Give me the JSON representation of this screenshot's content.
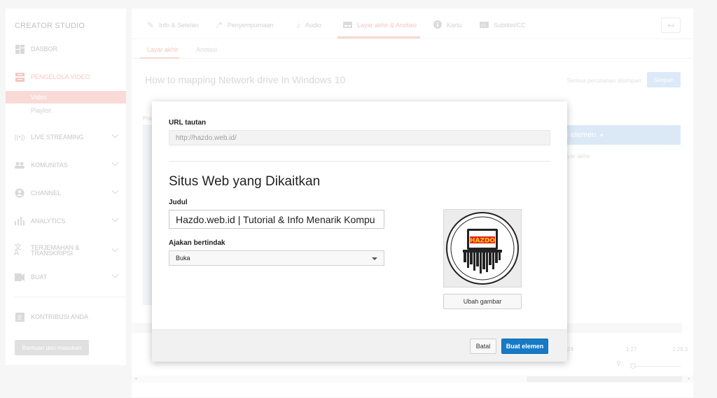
{
  "sidebar": {
    "studio_title": "CREATOR STUDIO",
    "items": [
      {
        "label": "DASBOR",
        "icon": "dashboard-icon"
      },
      {
        "label": "PENGELOLA VIDEO",
        "icon": "video-manager-icon"
      },
      {
        "label": "LIVE STREAMING",
        "icon": "live-icon"
      },
      {
        "label": "KOMUNITAS",
        "icon": "community-icon"
      },
      {
        "label": "CHANNEL",
        "icon": "channel-icon"
      },
      {
        "label": "ANALYTICS",
        "icon": "analytics-icon"
      },
      {
        "label": "TERJEMAHAN & TRANSKRIPSI",
        "icon": "translate-icon"
      },
      {
        "label": "BUAT",
        "icon": "create-icon"
      },
      {
        "label": "KONTRIBUSI ANDA",
        "icon": "contribution-icon"
      }
    ],
    "sub_items": [
      "Video",
      "Playlist"
    ],
    "help_button": "Bantuan dan masukan"
  },
  "tabs": [
    {
      "label": "Info & Setelan",
      "icon": "pencil-icon"
    },
    {
      "label": "Penyempurnaan",
      "icon": "magic-wand-icon"
    },
    {
      "label": "Audio",
      "icon": "music-note-icon"
    },
    {
      "label": "Layar akhir & Anotasi",
      "icon": "end-screen-icon"
    },
    {
      "label": "Kartu",
      "icon": "info-icon"
    },
    {
      "label": "Subtitel/CC",
      "icon": "cc-icon"
    }
  ],
  "subtabs": [
    "Layar akhir",
    "Anotasi"
  ],
  "main": {
    "video_title": "How to mapping Network drive In Windows 10",
    "saved_message": "Semua perubahan disimpan",
    "save_button": "Simpan",
    "preview_label": "Pra",
    "add_element": "h elemen",
    "end_screen_link": "yar akhir",
    "timeline_marks": [
      "24",
      "1:27",
      "1:29.3"
    ]
  },
  "modal": {
    "url_label": "URL tautan",
    "url_value": "http://hazdo.web.id/",
    "section_title": "Situs Web yang Dikaitkan",
    "title_label": "Judul",
    "title_value": "Hazdo.web.id | Tutorial & Info Menarik Kompu",
    "cta_label": "Ajakan bertindak",
    "cta_value": "Buka",
    "logo_text": "HAZDO",
    "change_image_button": "Ubah gambar",
    "cancel_button": "Batal",
    "create_button": "Buat elemen"
  },
  "colors": {
    "primary_button": "#167ac6",
    "accent_red": "#e62117"
  }
}
